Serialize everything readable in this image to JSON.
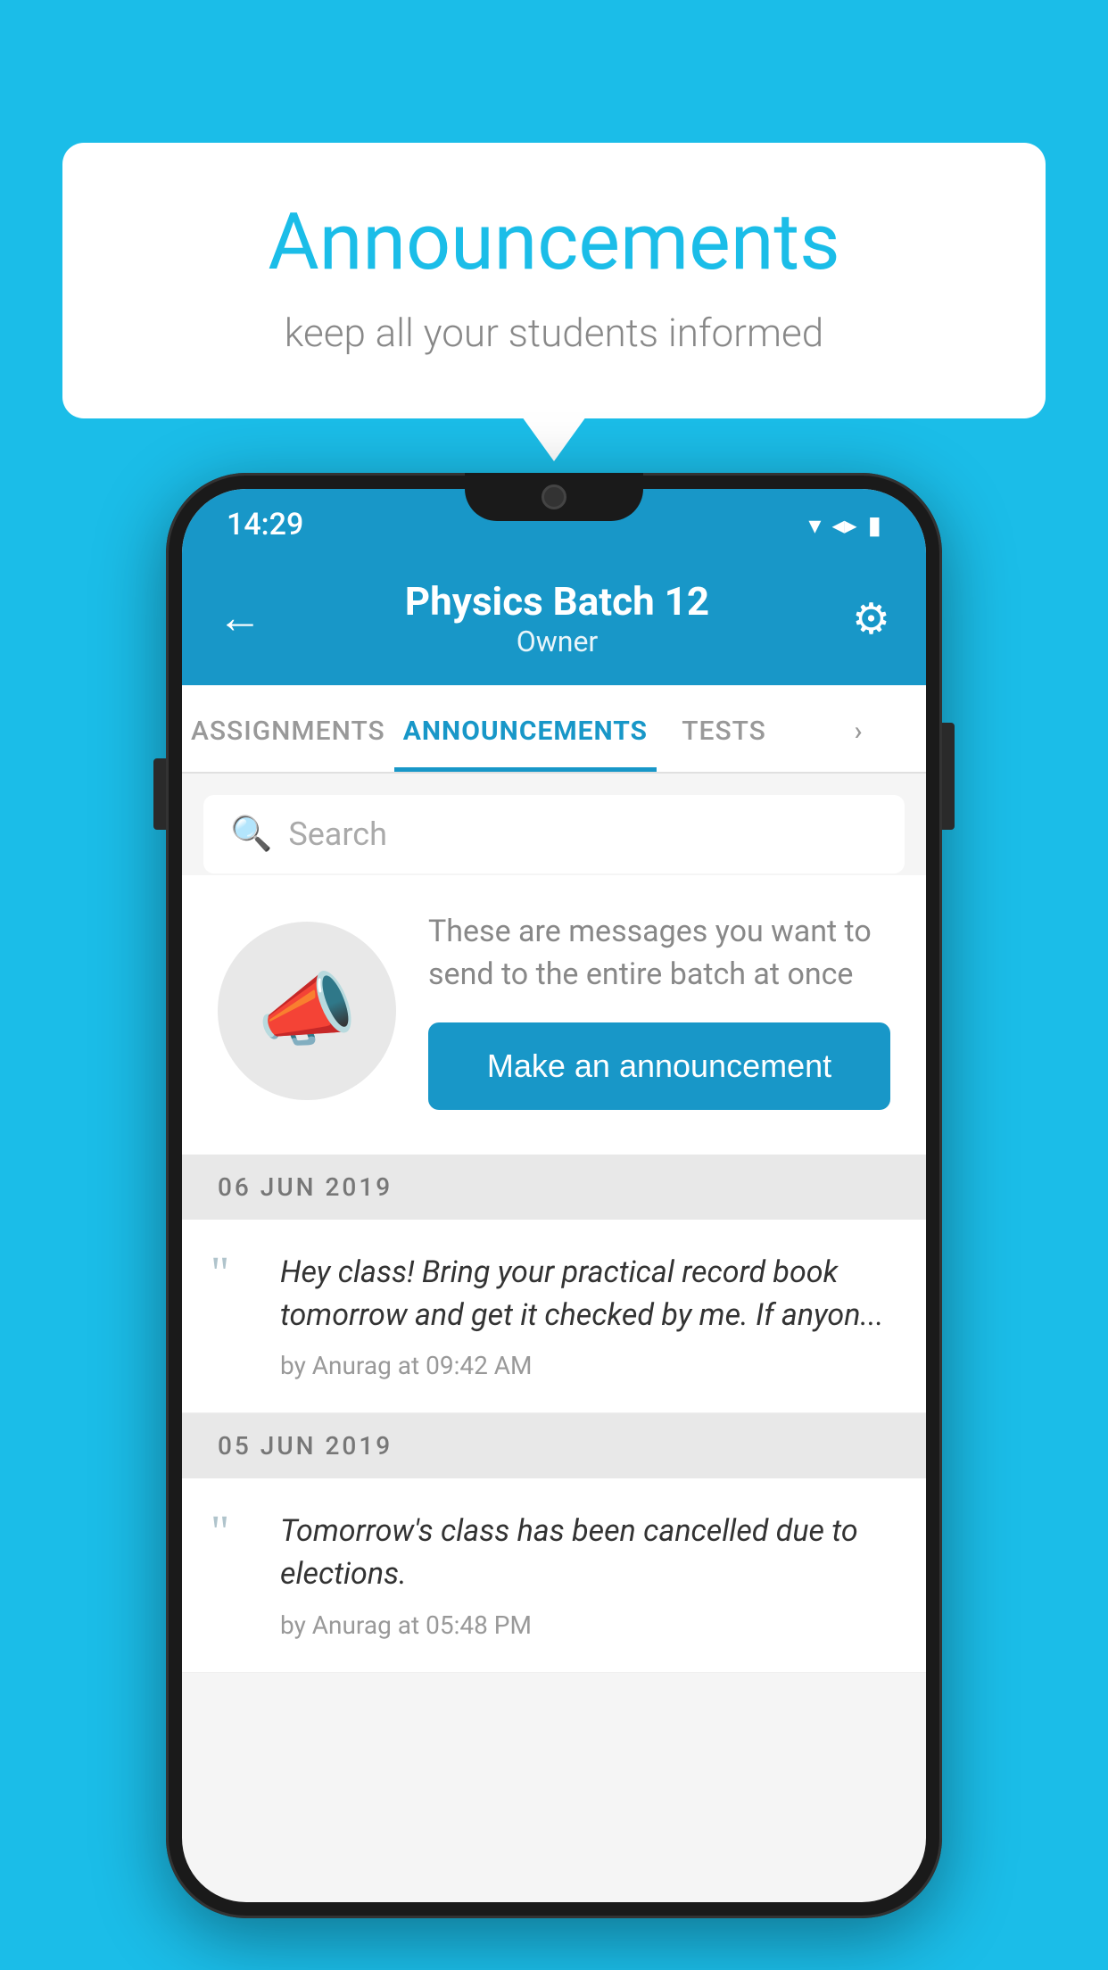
{
  "background_color": "#1BBDE8",
  "speech_bubble": {
    "title": "Announcements",
    "subtitle": "keep all your students informed"
  },
  "phone": {
    "status_bar": {
      "time": "14:29",
      "wifi": "▼",
      "signal": "▲",
      "battery": "▮"
    },
    "header": {
      "back_label": "←",
      "batch_name": "Physics Batch 12",
      "role": "Owner",
      "settings_label": "⚙"
    },
    "tabs": [
      {
        "label": "ASSIGNMENTS",
        "active": false
      },
      {
        "label": "ANNOUNCEMENTS",
        "active": true
      },
      {
        "label": "TESTS",
        "active": false
      },
      {
        "label": "›",
        "active": false
      }
    ],
    "search": {
      "placeholder": "Search"
    },
    "announcement_promo": {
      "icon": "📣",
      "description": "These are messages you want to send to the entire batch at once",
      "button_label": "Make an announcement"
    },
    "announcement_dates": [
      {
        "date": "06  JUN  2019",
        "items": [
          {
            "text": "Hey class! Bring your practical record book tomorrow and get it checked by me. If anyon...",
            "meta": "by Anurag at 09:42 AM"
          }
        ]
      },
      {
        "date": "05  JUN  2019",
        "items": [
          {
            "text": "Tomorrow's class has been cancelled due to elections.",
            "meta": "by Anurag at 05:48 PM"
          }
        ]
      }
    ]
  }
}
